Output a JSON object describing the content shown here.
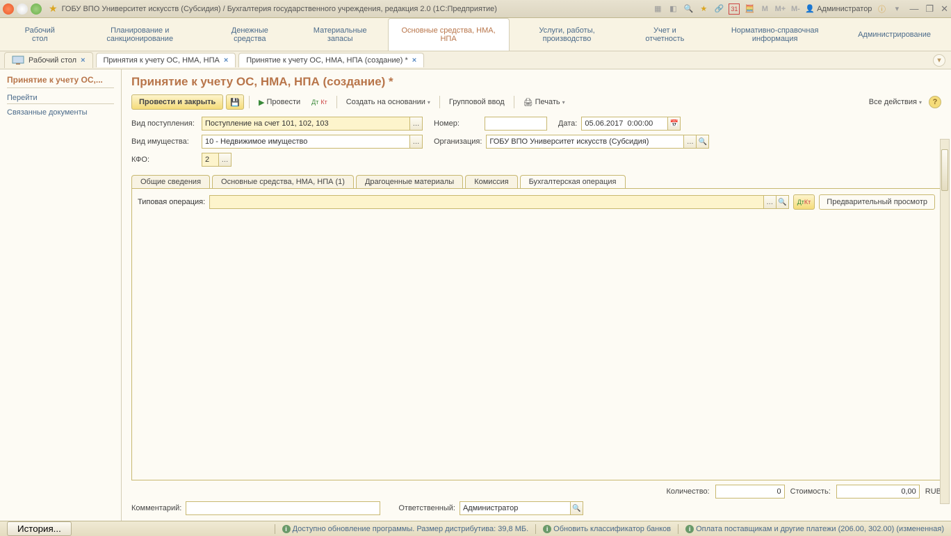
{
  "titlebar": {
    "title": "ГОБУ ВПО Университет искусств (Субсидия) / Бухгалтерия государственного учреждения, редакция 2.0  (1С:Предприятие)",
    "user": "Администратор",
    "m_labels": [
      "M",
      "M+",
      "M-"
    ],
    "date_badge": "31"
  },
  "mainnav": [
    "Рабочий стол",
    "Планирование и санкционирование",
    "Денежные средства",
    "Материальные запасы",
    "Основные средства, НМА, НПА",
    "Услуги, работы, производство",
    "Учет и отчетность",
    "Нормативно-справочная информация",
    "Администрирование"
  ],
  "tabs": [
    {
      "label": "Рабочий стол"
    },
    {
      "label": "Принятия к учету ОС, НМА, НПА"
    },
    {
      "label": "Принятие к учету ОС, НМА, НПА (создание) *"
    }
  ],
  "sidebar": {
    "title": "Принятие к учету ОС,...",
    "section": "Перейти",
    "link1": "Связанные документы"
  },
  "page": {
    "title": "Принятие к учету ОС, НМА, НПА (создание) *"
  },
  "toolbar": {
    "post_close": "Провести и закрыть",
    "post": "Провести",
    "create_based": "Создать на основании",
    "group_input": "Групповой ввод",
    "print": "Печать",
    "all_actions": "Все действия"
  },
  "form": {
    "vid_post_label": "Вид поступления:",
    "vid_post_value": "Поступление на счет 101, 102, 103",
    "number_label": "Номер:",
    "number_value": "",
    "date_label": "Дата:",
    "date_value": "05.06.2017  0:00:00",
    "vid_imush_label": "Вид имущества:",
    "vid_imush_value": "10 - Недвижимое имущество",
    "org_label": "Организация:",
    "org_value": "ГОБУ ВПО Университет искусств (Субсидия)",
    "kfo_label": "КФО:",
    "kfo_value": "2"
  },
  "form_tabs": [
    "Общие сведения",
    "Основные средства, НМА, НПА (1)",
    "Драгоценные материалы",
    "Комиссия",
    "Бухгалтерская операция"
  ],
  "tab_content": {
    "typop_label": "Типовая операция:",
    "typop_value": "",
    "preview_btn": "Предварительный просмотр"
  },
  "totals": {
    "qty_label": "Количество:",
    "qty_value": "0",
    "cost_label": "Стоимость:",
    "cost_value": "0,00",
    "currency": "RUB"
  },
  "comment": {
    "label": "Комментарий:",
    "value": "",
    "resp_label": "Ответственный:",
    "resp_value": "Администратор"
  },
  "statusbar": {
    "history": "История...",
    "link1": "Доступно обновление программы. Размер дистрибутива: 39,8 МБ.",
    "link2": "Обновить классификатор банков",
    "link3": "Оплата поставщикам и другие платежи (206.00, 302.00) (измененная)"
  }
}
